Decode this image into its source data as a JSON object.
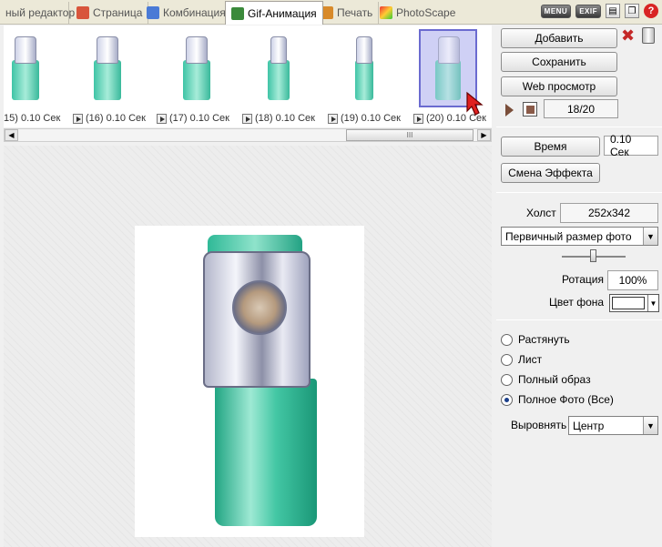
{
  "tabs": [
    {
      "label": "ный редактор",
      "icon": "editor-icon"
    },
    {
      "label": "Страница",
      "icon": "page-icon"
    },
    {
      "label": "Комбинация",
      "icon": "combine-icon"
    },
    {
      "label": "Gif-Анимация",
      "icon": "gif-icon",
      "active": true
    },
    {
      "label": "Печать",
      "icon": "print-icon"
    },
    {
      "label": "PhotoScape",
      "icon": "photoscape-icon"
    }
  ],
  "top_tools": {
    "menu": "MENU",
    "exif": "EXIF"
  },
  "filmstrip": {
    "frames": [
      {
        "label": "15) 0.10 Сек"
      },
      {
        "label": "(16) 0.10 Сек"
      },
      {
        "label": "(17) 0.10 Сек"
      },
      {
        "label": "(18) 0.10 Сек"
      },
      {
        "label": "(19) 0.10 Сек"
      },
      {
        "label": "(20) 0.10 Сек",
        "selected": true
      }
    ],
    "scroll_thumb": "III"
  },
  "panel": {
    "add_label": "Добавить",
    "save_label": "Сохранить",
    "web_preview_label": "Web просмотр",
    "frame_counter": "18/20",
    "time_label": "Время",
    "time_value": "0.10 Сек",
    "change_effect_label": "Смена Эффекта",
    "canvas_label": "Холст",
    "canvas_value": "252x342",
    "size_select": "Первичный размер фото",
    "rotation_label": "Ротация",
    "rotation_value": "100%",
    "bg_color_label": "Цвет фона",
    "bg_color": "#ffffff",
    "radios": [
      {
        "label": "Растянуть",
        "checked": false
      },
      {
        "label": "Лист",
        "checked": false
      },
      {
        "label": "Полный образ",
        "checked": false
      },
      {
        "label": "Полное Фото (Все)",
        "checked": true
      }
    ],
    "align_label": "Выровнять",
    "align_value": "Центр"
  },
  "colors": {
    "accent_selected_frame": "#6b6bd0",
    "bottle_green": "#3fc4a6"
  }
}
